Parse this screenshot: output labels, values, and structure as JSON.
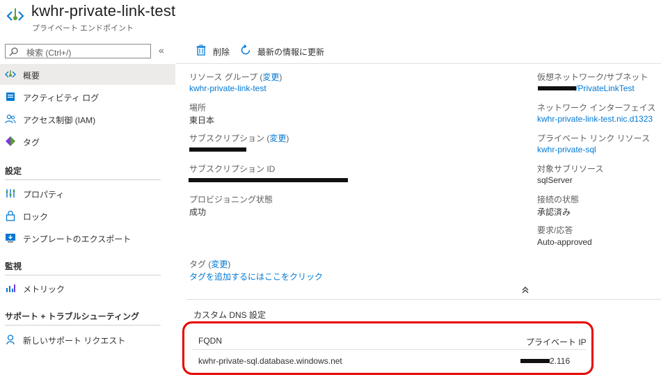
{
  "header": {
    "title": "kwhr-private-link-test",
    "subtitle": "プライベート エンドポイント"
  },
  "sidebar": {
    "search_placeholder": "検索 (Ctrl+/)",
    "collapse_glyph": "«",
    "items": [
      {
        "label": "概要",
        "icon": "endpoint-icon"
      },
      {
        "label": "アクティビティ ログ",
        "icon": "activity-log-icon"
      },
      {
        "label": "アクセス制御 (IAM)",
        "icon": "people-icon"
      },
      {
        "label": "タグ",
        "icon": "tag-icon"
      }
    ],
    "sections": [
      {
        "title": "設定",
        "items": [
          {
            "label": "プロパティ",
            "icon": "properties-icon"
          },
          {
            "label": "ロック",
            "icon": "lock-icon"
          },
          {
            "label": "テンプレートのエクスポート",
            "icon": "export-template-icon"
          }
        ]
      },
      {
        "title": "監視",
        "items": [
          {
            "label": "メトリック",
            "icon": "metrics-icon"
          }
        ]
      },
      {
        "title": "サポート + トラブルシューティング",
        "items": [
          {
            "label": "新しいサポート リクエスト",
            "icon": "support-icon"
          }
        ]
      }
    ]
  },
  "toolbar": {
    "delete_label": "削除",
    "refresh_label": "最新の情報に更新"
  },
  "essentials": {
    "change_label": "変更",
    "resource_group_label": "リソース グループ",
    "resource_group_value": "kwhr-private-link-test",
    "location_label": "場所",
    "location_value": "東日本",
    "subscription_label": "サブスクリプション",
    "subscription_id_label": "サブスクリプション ID",
    "provisioning_label": "プロビジョニング状態",
    "provisioning_value": "成功",
    "vnet_label": "仮想ネットワーク/サブネット",
    "vnet_value": "/PrivateLinkTest",
    "nic_label": "ネットワーク インターフェイス",
    "nic_value": "kwhr-private-link-test.nic.d1323",
    "pl_resource_label": "プライベート リンク リソース",
    "pl_resource_value": "kwhr-private-sql",
    "target_sub_label": "対象サブリソース",
    "target_sub_value": "sqlServer",
    "connection_label": "接続の状態",
    "connection_value": "承認済み",
    "request_label": "要求/応答",
    "request_value": "Auto-approved",
    "tags_label": "タグ",
    "tags_add_link": "タグを追加するにはここをクリック"
  },
  "dns": {
    "title": "カスタム DNS 設定",
    "col_fqdn": "FQDN",
    "col_ip": "プライベート IP",
    "rows": [
      {
        "fqdn": "kwhr-private-sql.database.windows.net",
        "ip_suffix": "2.116"
      }
    ]
  },
  "colors": {
    "link": "#0078d4",
    "highlight_border": "#e60000",
    "selected_bg": "#edebe9"
  }
}
